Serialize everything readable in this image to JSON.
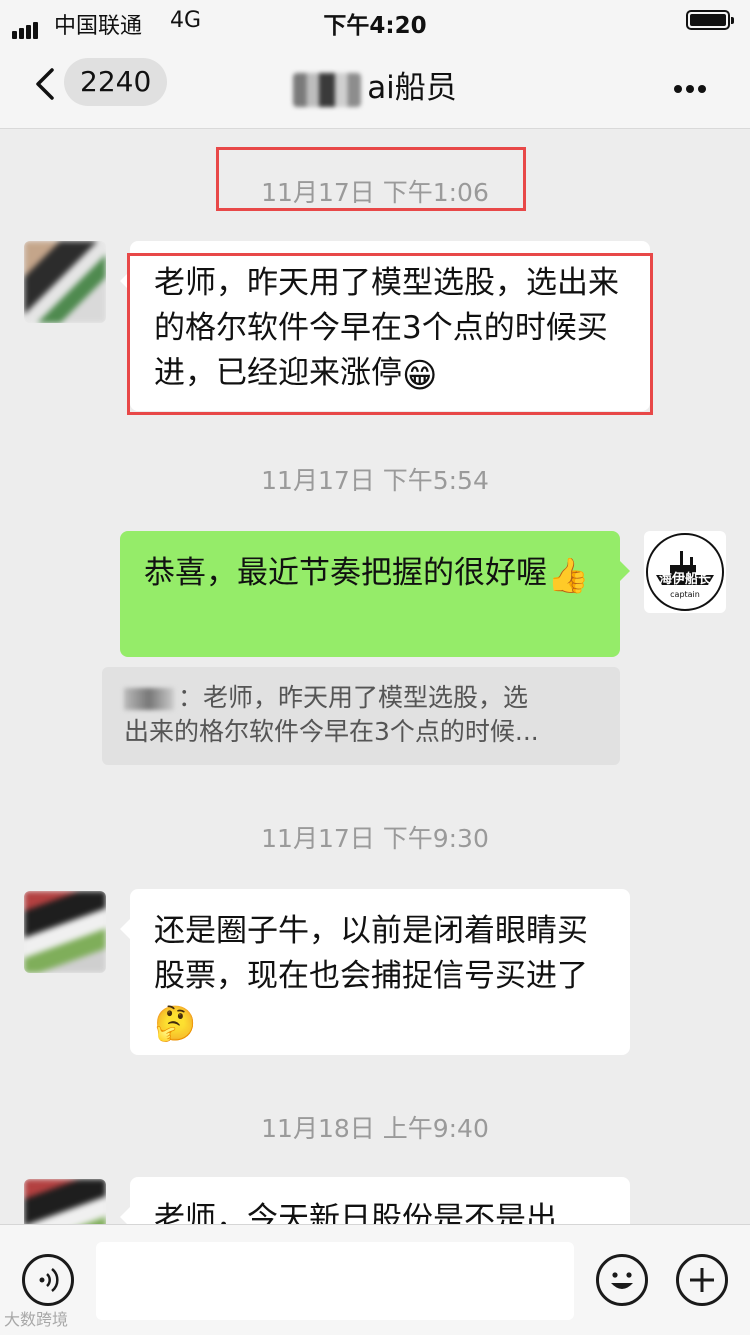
{
  "status_bar": {
    "carrier": "中国联通",
    "network": "4G",
    "time": "下午4:20",
    "battery_level": 1.0
  },
  "header": {
    "back_icon": "chevron-left-icon",
    "unread_count": "2240",
    "title_suffix": "ai船员",
    "more_icon": "more-dots-icon"
  },
  "messages": {
    "t1": "11月17日 下午1:06",
    "m1": {
      "text": "老师，昨天用了模型选股，选出来的格尔软件今早在3个点的时候买进，已经迎来涨停",
      "emoji": "😁"
    },
    "t2": "11月17日 下午5:54",
    "m2": {
      "text": "恭喜，最近节奏把握的很好喔",
      "emoji": "👍",
      "avatar_text": "海伊船长",
      "avatar_subtext": "captain"
    },
    "quote": {
      "line1": "：老师，昨天用了模型选股，选",
      "line2": "出来的格尔软件今早在3个点的时候..."
    },
    "t3": "11月17日 下午9:30",
    "m3": {
      "text": "还是圈子牛，以前是闭着眼睛买股票，现在也会捕捉信号买进了",
      "emoji": "🤔"
    },
    "t4": "11月18日 上午9:40",
    "m4": {
      "text": "老师，今天新日股份是不是出"
    }
  },
  "input_bar": {
    "voice_icon": "voice-icon",
    "emoji_icon": "smiley-icon",
    "plus_icon": "plus-icon"
  },
  "watermark": "大数跨境",
  "colors": {
    "background": "#ededed",
    "self_bubble": "#95ec69",
    "other_bubble": "#ffffff",
    "highlight_box": "#e84848"
  }
}
